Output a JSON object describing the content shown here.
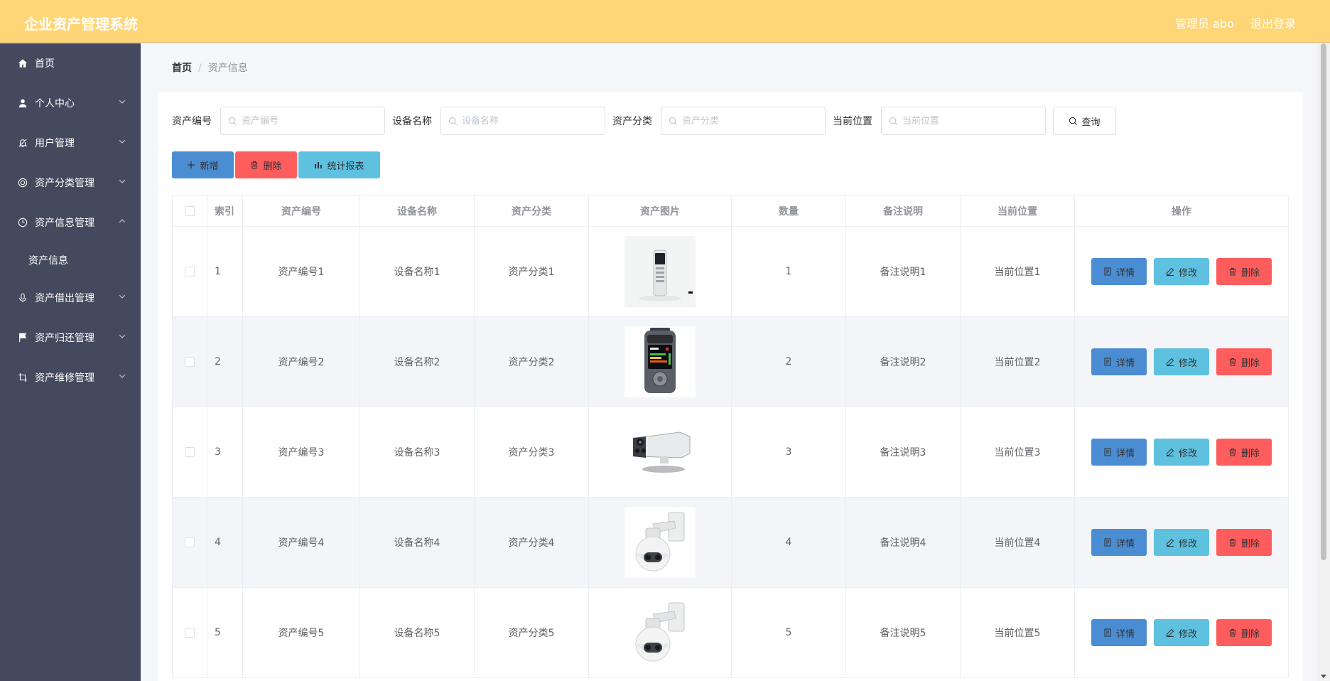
{
  "header": {
    "title": "企业资产管理系统",
    "user": "管理员 abo",
    "logout": "退出登录"
  },
  "sidebar": {
    "items": [
      {
        "label": "首页",
        "icon": "home-icon"
      },
      {
        "label": "个人中心",
        "icon": "user-icon"
      },
      {
        "label": "用户管理",
        "icon": "bell-off-icon"
      },
      {
        "label": "资产分类管理",
        "icon": "lifebuoy-icon"
      },
      {
        "label": "资产信息管理",
        "icon": "clock-icon"
      },
      {
        "label": "资产借出管理",
        "icon": "microphone-icon"
      },
      {
        "label": "资产归还管理",
        "icon": "flag-icon"
      },
      {
        "label": "资产维修管理",
        "icon": "crop-icon"
      }
    ],
    "subitem": "资产信息"
  },
  "breadcrumb": {
    "home": "首页",
    "separator": "/",
    "current": "资产信息"
  },
  "search": {
    "code_label": "资产编号",
    "code_placeholder": "资产编号",
    "name_label": "设备名称",
    "name_placeholder": "设备名称",
    "category_label": "资产分类",
    "category_placeholder": "资产分类",
    "location_label": "当前位置",
    "location_placeholder": "当前位置",
    "query_label": "查询"
  },
  "actions": {
    "add": "新增",
    "delete": "删除",
    "report": "统计报表"
  },
  "table": {
    "headers": [
      "索引",
      "资产编号",
      "设备名称",
      "资产分类",
      "资产图片",
      "数量",
      "备注说明",
      "当前位置",
      "操作"
    ],
    "rows": [
      {
        "index": "1",
        "code": "资产编号1",
        "name": "设备名称1",
        "category": "资产分类1",
        "image": "voice-recorder",
        "qty": "1",
        "note": "备注说明1",
        "location": "当前位置1"
      },
      {
        "index": "2",
        "code": "资产编号2",
        "name": "设备名称2",
        "category": "资产分类2",
        "image": "digital-recorder",
        "qty": "2",
        "note": "备注说明2",
        "location": "当前位置2"
      },
      {
        "index": "3",
        "code": "资产编号3",
        "name": "设备名称3",
        "category": "资产分类3",
        "image": "bullet-camera",
        "qty": "3",
        "note": "备注说明3",
        "location": "当前位置3"
      },
      {
        "index": "4",
        "code": "资产编号4",
        "name": "设备名称4",
        "category": "资产分类4",
        "image": "dome-camera",
        "qty": "4",
        "note": "备注说明4",
        "location": "当前位置4"
      },
      {
        "index": "5",
        "code": "资产编号5",
        "name": "设备名称5",
        "category": "资产分类5",
        "image": "dome-camera",
        "qty": "5",
        "note": "备注说明5",
        "location": "当前位置5"
      }
    ],
    "ops": {
      "detail": "详情",
      "edit": "修改",
      "delete": "删除"
    }
  },
  "colors": {
    "header_bg": "#ffd677",
    "sidebar_bg": "#434a5d",
    "primary": "#4b8dd2",
    "danger": "#fe5d5d",
    "info": "#5ec1e0",
    "stripe": "#f4f5f8"
  }
}
